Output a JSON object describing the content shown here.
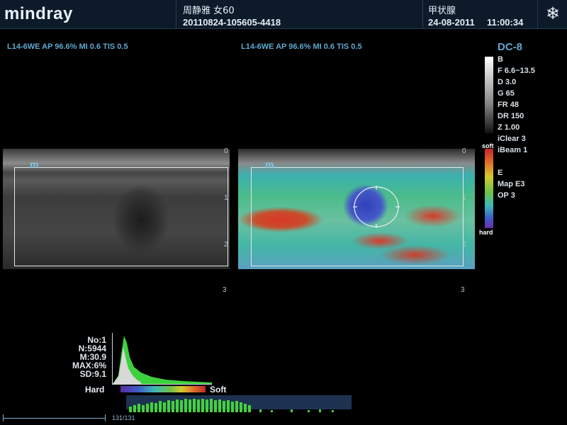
{
  "header": {
    "logo": "mindray",
    "patient_name": "周静雅 女60",
    "patient_id": "20110824-105605-4418",
    "exam": "甲状腺",
    "date": "24-08-2011",
    "time": "11:00:34",
    "freeze_icon": "snowflake-icon"
  },
  "left_panel": {
    "probe_info": "L14-6WE  AP 96.6%  MI 0.6  TIS 0.5",
    "marker": "m",
    "depth_ticks": [
      "0",
      "1",
      "2",
      "3"
    ]
  },
  "right_panel": {
    "probe_info": "L14-6WE  AP 96.6%  MI 0.6  TIS 0.5",
    "marker": "m",
    "depth_ticks": [
      "0",
      "1",
      "2",
      "3"
    ]
  },
  "params": {
    "title": "DC-8",
    "lines": [
      "B",
      "F 6.6~13.5",
      "D 3.0",
      "G 65",
      "FR 48",
      "DR 150",
      "Z 1.00",
      "iClear 3",
      "iBeam 1",
      "",
      "E",
      "Map E3",
      "OP 3"
    ],
    "soft_label": "soft",
    "hard_label": "hard"
  },
  "stats": {
    "no": "No:1",
    "n": "N:5944",
    "m": "M:30.9",
    "max": "MAX:6%",
    "sd": "SD:9.1"
  },
  "histogram": {
    "hard_label": "Hard",
    "soft_label": "Soft",
    "frame_counter": "131/131"
  }
}
